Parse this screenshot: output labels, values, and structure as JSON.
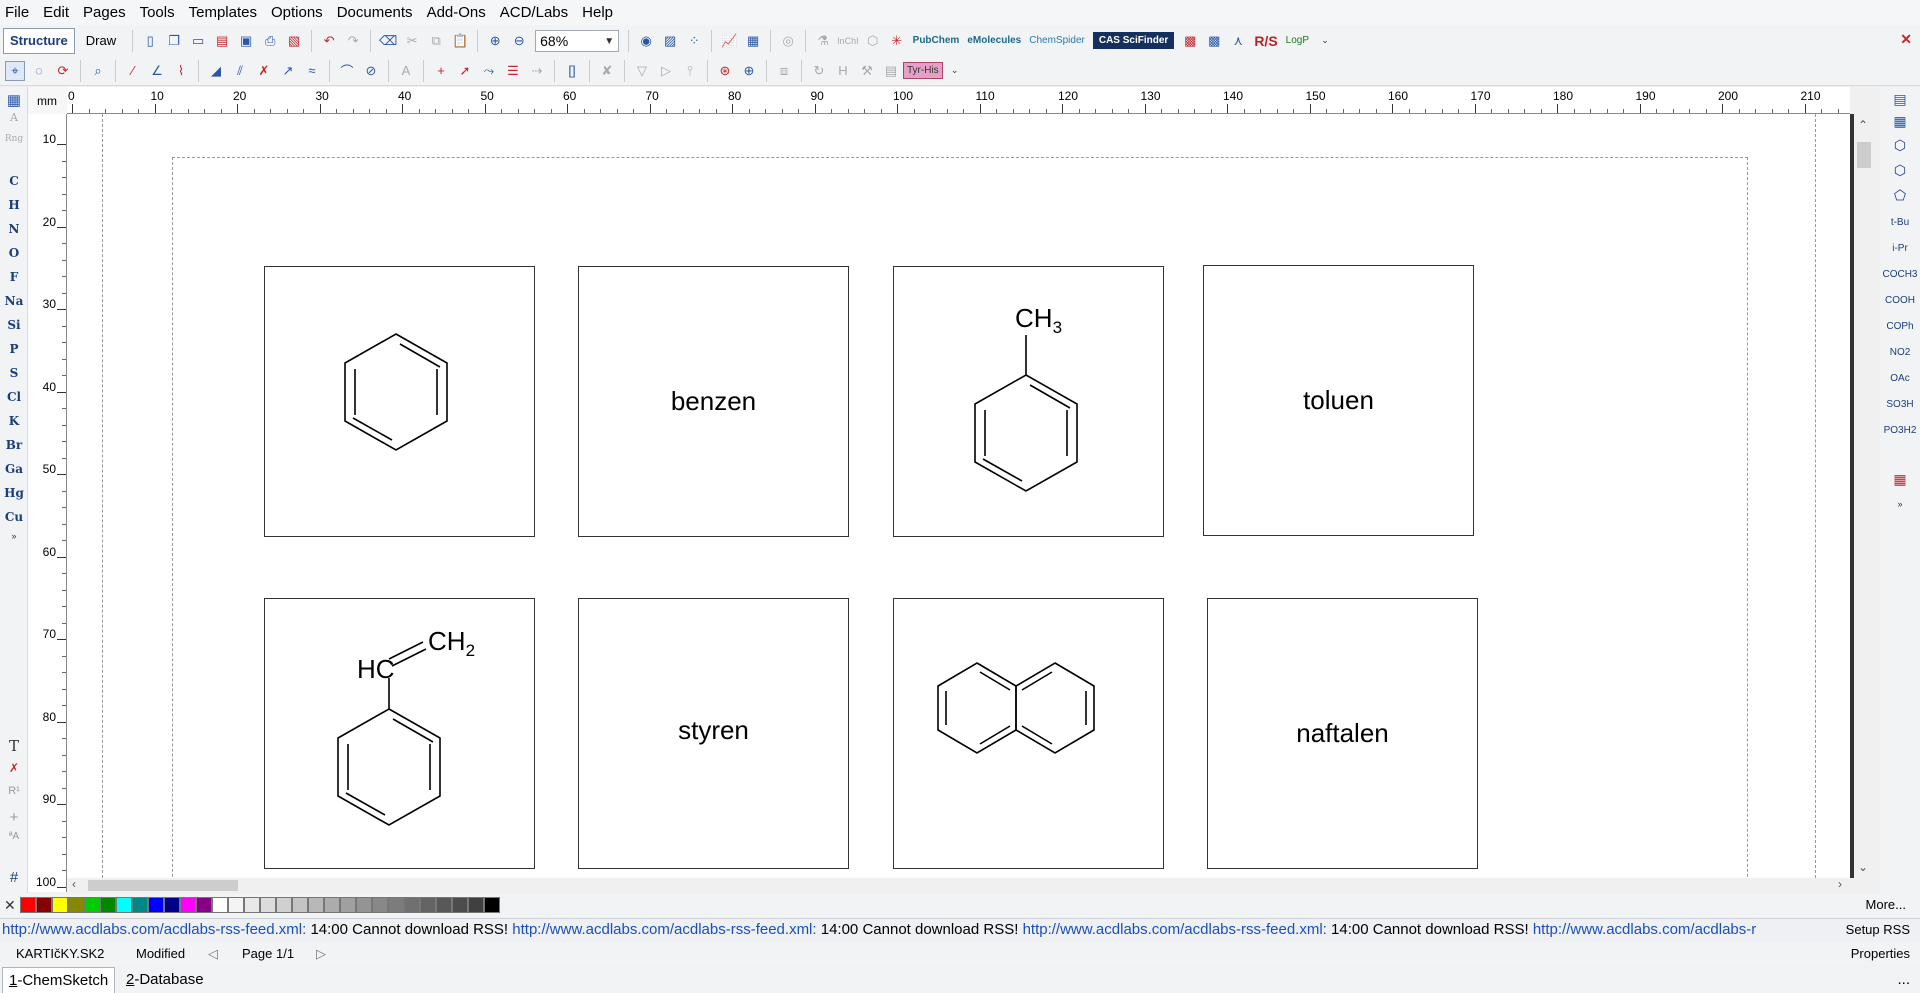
{
  "menu": [
    "File",
    "Edit",
    "Pages",
    "Tools",
    "Templates",
    "Options",
    "Documents",
    "Add-Ons",
    "ACD/Labs",
    "Help"
  ],
  "toolbar": {
    "mode_structure": "Structure",
    "mode_draw": "Draw",
    "zoom": "68%",
    "pubchem": "PubChem",
    "emolecules": "eMolecules",
    "chemspider": "ChemSpider",
    "scifinder": "CAS SciFinder",
    "rs": "R/S",
    "logp": "LogP",
    "inchi": "InChI"
  },
  "toolbar2": {
    "amino": "Tyr-His"
  },
  "left_panel": {
    "elements": [
      "C",
      "H",
      "N",
      "O",
      "F",
      "Na",
      "Si",
      "P",
      "S",
      "Cl",
      "K",
      "Br",
      "Ga",
      "Hg",
      "Cu"
    ],
    "dim_top": [
      "A",
      "Rng"
    ]
  },
  "rulers": {
    "unit": "mm",
    "h_labels": [
      "0",
      "10",
      "20",
      "30",
      "40",
      "50",
      "60",
      "70",
      "80",
      "90",
      "100",
      "110",
      "120",
      "130",
      "140",
      "150",
      "160",
      "170",
      "180",
      "190",
      "200",
      "210"
    ],
    "v_labels": [
      "10",
      "20",
      "30",
      "40",
      "50",
      "60",
      "70",
      "80",
      "90",
      "100"
    ]
  },
  "cards": {
    "benzen": "benzen",
    "toluen": "toluen",
    "styren": "styren",
    "naftalen": "naftalen",
    "ch3": "CH",
    "ch3_sub": "3",
    "hc": "HC",
    "ch2": "CH",
    "ch2_sub": "2"
  },
  "right_panel": [
    "t-Bu",
    "i-Pr",
    "COCH3",
    "COOH",
    "COPh",
    "NO2",
    "OAc",
    "SO3H",
    "PO3H2"
  ],
  "palette": {
    "colors": [
      "#ff0000",
      "#880000",
      "#ffff00",
      "#888800",
      "#00cc00",
      "#008800",
      "#00ffff",
      "#008888",
      "#0000ff",
      "#000088",
      "#ff00ff",
      "#880088",
      "#ffffff",
      "#f4f4f4",
      "#e8e8e8",
      "#dcdcdc",
      "#d0d0d0",
      "#c4c4c4",
      "#b8b8b8",
      "#acacac",
      "#a0a0a0",
      "#949494",
      "#888888",
      "#7c7c7c",
      "#707070",
      "#646464",
      "#585858",
      "#4c4c4c",
      "#404040",
      "#000000"
    ],
    "more": "More..."
  },
  "rss": {
    "url": "http://www.acdlabs.com/acdlabs-rss-feed.xml:",
    "time": "14:00",
    "msg": "Cannot download RSS!",
    "url_tail": "http://www.acdlabs.com/acdlabs-r",
    "setup": "Setup RSS"
  },
  "status": {
    "file": "KARTIčKY.SK2",
    "modified": "Modified",
    "page": "Page 1/1",
    "properties": "Properties"
  },
  "tabs": [
    {
      "num": "1",
      "label": "-ChemSketch"
    },
    {
      "num": "2",
      "label": "-Database"
    }
  ],
  "tabs_more": "..."
}
